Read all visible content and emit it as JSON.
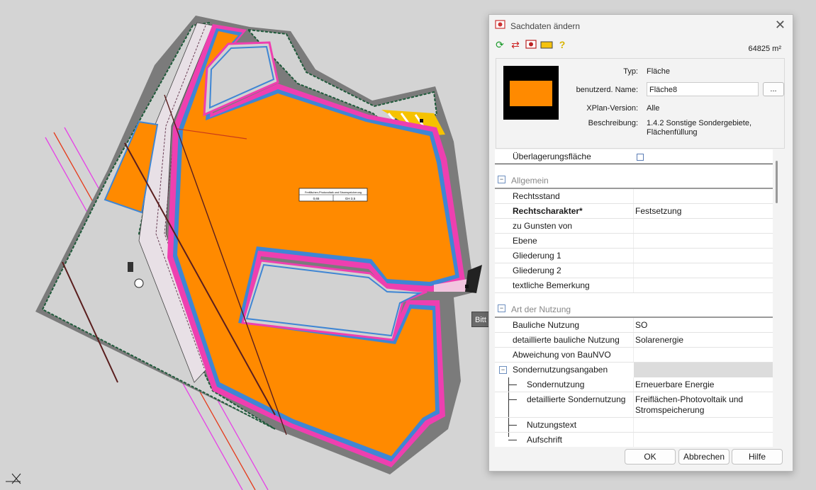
{
  "dialog": {
    "title": "Sachdaten ändern",
    "area": "64825  m²",
    "props": {
      "typ_label": "Typ:",
      "typ_value": "Fläche",
      "name_label": "benutzerd. Name:",
      "name_value": "Fläche8",
      "xplan_label": "XPlan-Version:",
      "xplan_value": "Alle",
      "desc_label": "Beschreibung:",
      "desc_value_1": "1.4.2 Sonstige Sondergebiete,",
      "desc_value_2": "Flächenfüllung",
      "dots_label": "..."
    },
    "grid": {
      "overlay_label": "Überlagerungsfläche",
      "sec1": "Allgemein",
      "rows1": [
        {
          "k": "Rechtsstand",
          "v": ""
        },
        {
          "k": "Rechtscharakter*",
          "v": "Festsetzung"
        },
        {
          "k": "zu Gunsten von",
          "v": ""
        },
        {
          "k": "Ebene",
          "v": ""
        },
        {
          "k": "Gliederung 1",
          "v": ""
        },
        {
          "k": "Gliederung 2",
          "v": ""
        },
        {
          "k": "textliche Bemerkung",
          "v": ""
        }
      ],
      "sec2": "Art der Nutzung",
      "rows2": [
        {
          "k": "Bauliche Nutzung",
          "v": "SO"
        },
        {
          "k": "detaillierte bauliche Nutzung",
          "v": "Solarenergie"
        },
        {
          "k": "Abweichung von BauNVO",
          "v": ""
        }
      ],
      "sub": "Sondernutzungsangaben",
      "sub_rows": [
        {
          "k": "Sondernutzung",
          "v": "Erneuerbare Energie"
        },
        {
          "k": "detaillierte Sondernutzung",
          "v": "Freiflächen-Photovoltaik und",
          "v2": "Stromspeicherung"
        },
        {
          "k": "Nutzungstext",
          "v": ""
        },
        {
          "k": "Aufschrift",
          "v": ""
        }
      ]
    },
    "buttons": {
      "ok": "OK",
      "cancel": "Abbrechen",
      "help": "Hilfe"
    }
  },
  "tooltip": "Bitt",
  "map_labels": {
    "table_title": "Freiflächen-Photovoltaik und Stromspeicherung",
    "grz": "0,65",
    "gh": "GH 3,5"
  },
  "colors": {
    "orange": "#ff8a00",
    "pink": "#ee3fb0",
    "blue": "#3f86d4",
    "gray": "#6f6f6f",
    "green": "#1e5a3a"
  }
}
